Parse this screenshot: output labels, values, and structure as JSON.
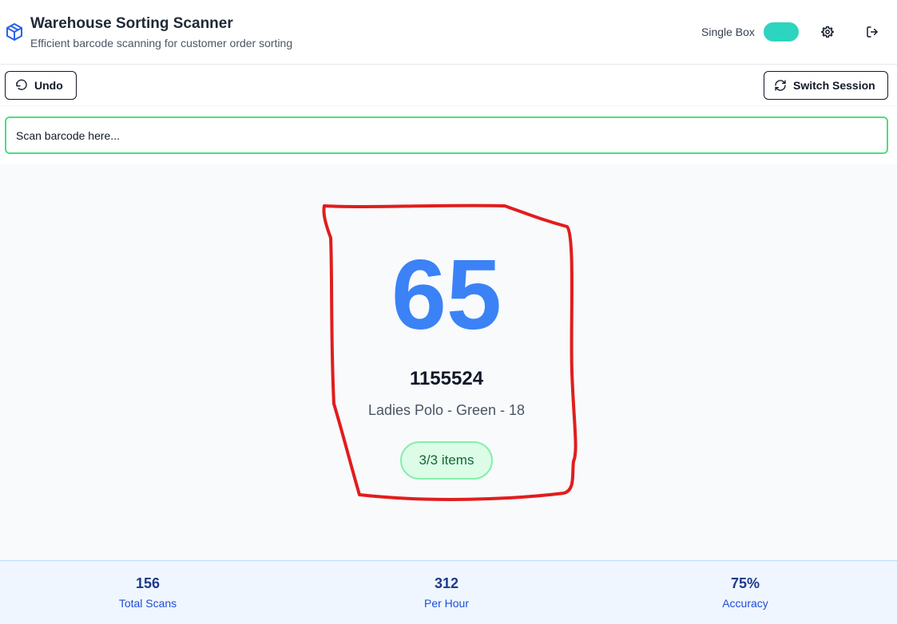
{
  "header": {
    "title": "Warehouse Sorting Scanner",
    "subtitle": "Efficient barcode scanning for customer order sorting",
    "logo_icon": "package-icon",
    "toggle_label": "Single Box",
    "toggle_on": true,
    "settings_icon": "gear-icon",
    "logout_icon": "logout-icon"
  },
  "toolbar": {
    "undo_label": "Undo",
    "switch_label": "Switch Session"
  },
  "scan": {
    "placeholder": "Scan barcode here..."
  },
  "result": {
    "bin_number": "65",
    "sku": "1155524",
    "product": "Ladies Polo - Green - 18",
    "items_badge": "3/3 items"
  },
  "stats": [
    {
      "value": "156",
      "label": "Total Scans"
    },
    {
      "value": "312",
      "label": "Per Hour"
    },
    {
      "value": "75%",
      "label": "Accuracy"
    }
  ],
  "colors": {
    "accent": "#3b82f6",
    "toggle": "#2dd4bf",
    "success_border": "#4ade80",
    "annotation": "#e11d1d"
  }
}
